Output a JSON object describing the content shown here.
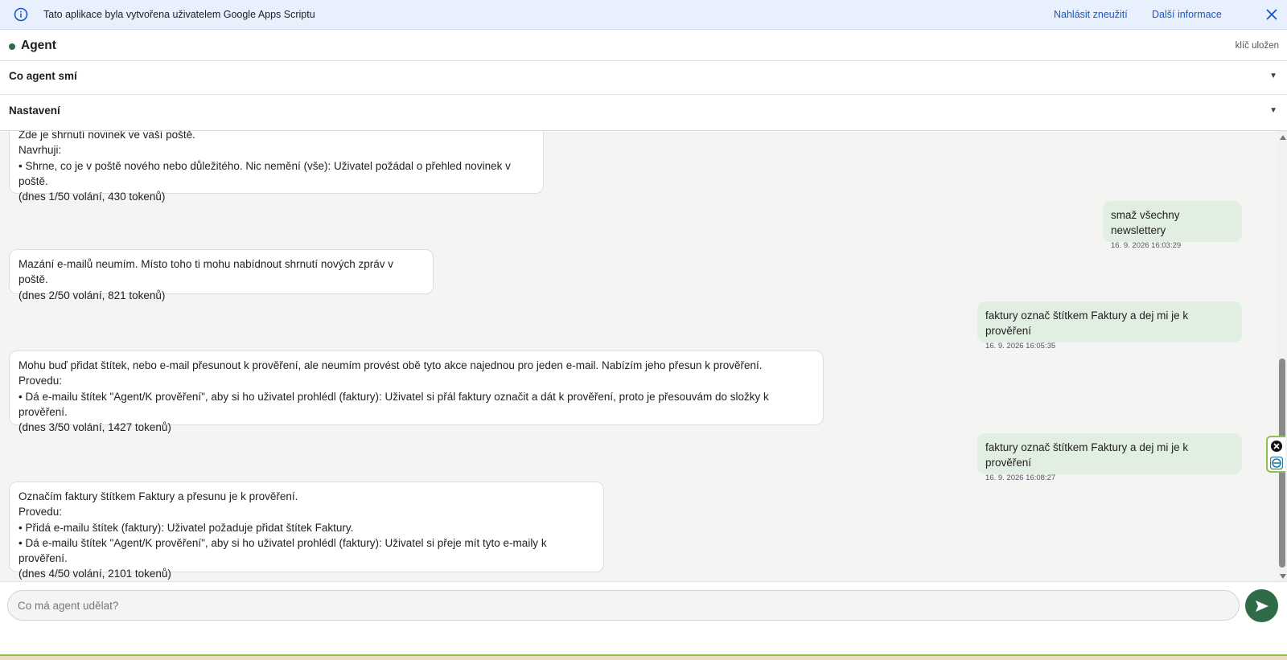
{
  "banner": {
    "text": "Tato aplikace byla vytvořena uživatelem Google Apps Scriptu",
    "report_link": "Nahlásit zneužití",
    "more_link": "Další informace"
  },
  "header": {
    "title": "Agent",
    "key_status": "klíč uložen",
    "sections": [
      {
        "label": "Co agent smí",
        "caret": "▼"
      },
      {
        "label": "Nastavení",
        "caret": "▼"
      }
    ]
  },
  "messages": [
    {
      "role": "agent",
      "lines": [
        "Zde je shrnutí novinek ve vaší poště.",
        "Navrhuji:",
        "• Shrne, co je v poště nového nebo důležitého. Nic nemění (vše): Uživatel požádal o přehled novinek v poště.",
        "(dnes 1/50 volání, 430 tokenů)"
      ]
    },
    {
      "role": "user",
      "text": "smaž všechny newslettery",
      "timestamp": "16. 9. 2026 16:03:29"
    },
    {
      "role": "agent",
      "lines": [
        "Mazání e-mailů neumím. Místo toho ti mohu nabídnout shrnutí nových zpráv v poště.",
        "(dnes 2/50 volání, 821 tokenů)"
      ]
    },
    {
      "role": "user",
      "text": "faktury označ štítkem Faktury a dej mi je k prověření",
      "timestamp": "16. 9. 2026 16:05:35"
    },
    {
      "role": "agent",
      "lines": [
        "Mohu buď přidat štítek, nebo e-mail přesunout k prověření, ale neumím provést obě tyto akce najednou pro jeden e-mail. Nabízím jeho přesun k prověření.",
        "Provedu:",
        "• Dá e-mailu štítek \"Agent/K prověření\", aby si ho uživatel prohlédl (faktury): Uživatel si přál faktury označit a dát k prověření, proto je přesouvám do složky k prověření.",
        "(dnes 3/50 volání, 1427 tokenů)"
      ]
    },
    {
      "role": "user",
      "text": "faktury označ štítkem Faktury a dej mi je k prověření",
      "timestamp": "16. 9. 2026 16:08:27"
    },
    {
      "role": "agent",
      "lines": [
        "Označím faktury štítkem Faktury a přesunu je k prověření.",
        "Provedu:",
        "• Přidá e-mailu štítek (faktury): Uživatel požaduje přidat štítek Faktury.",
        "• Dá e-mailu štítek \"Agent/K prověření\", aby si ho uživatel prohlédl (faktury): Uživatel si přeje mít tyto e-maily k prověření.",
        "(dnes 4/50 volání, 2101 tokenů)"
      ]
    }
  ],
  "composer": {
    "placeholder": "Co má agent udělat?"
  },
  "colors": {
    "accent": "#2e6b46",
    "user_bubble": "#e1eee2",
    "banner_bg": "#e8f0fe",
    "link": "#1a57c4"
  }
}
